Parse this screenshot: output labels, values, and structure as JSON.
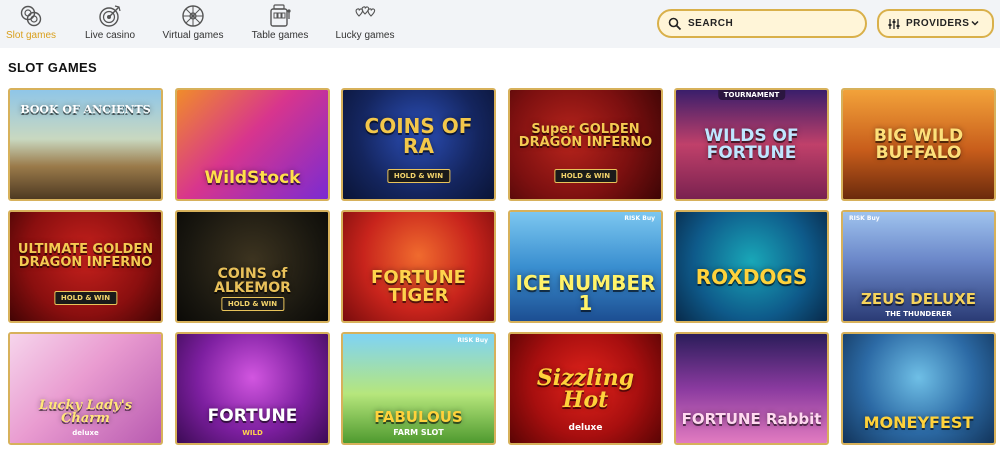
{
  "nav": {
    "items": [
      {
        "label": "Slot games",
        "icon": "slot-chips-icon"
      },
      {
        "label": "Live casino",
        "icon": "target-icon"
      },
      {
        "label": "Virtual games",
        "icon": "wheel-icon"
      },
      {
        "label": "Table games",
        "icon": "slot-machine-icon"
      },
      {
        "label": "Lucky games",
        "icon": "hearts-icon"
      }
    ],
    "active_color": "#d9a01e"
  },
  "search": {
    "placeholder": "SEARCH"
  },
  "providers": {
    "label": "PROVIDERS"
  },
  "section": {
    "title": "SLOT GAMES"
  },
  "games": [
    {
      "title": "BOOK OF ANCIENTS",
      "badge": "",
      "tag": "",
      "risk": "",
      "sub": ""
    },
    {
      "title": "WildStock",
      "badge": "",
      "tag": "",
      "risk": "",
      "sub": ""
    },
    {
      "title": "COINS OF RA",
      "badge": "HOLD & WIN",
      "tag": "",
      "risk": "",
      "sub": ""
    },
    {
      "title": "Super GOLDEN DRAGON INFERNO",
      "badge": "HOLD & WIN",
      "tag": "",
      "risk": "",
      "sub": ""
    },
    {
      "title": "WILDS OF FORTUNE",
      "badge": "",
      "tag": "TOURNAMENT",
      "risk": "",
      "sub": ""
    },
    {
      "title": "BIG WILD BUFFALO",
      "badge": "",
      "tag": "",
      "risk": "",
      "sub": ""
    },
    {
      "title": "ULTIMATE GOLDEN DRAGON INFERNO",
      "badge": "HOLD & WIN",
      "tag": "",
      "risk": "",
      "sub": ""
    },
    {
      "title": "COINS of ALKEMOR",
      "badge": "HOLD & WIN",
      "tag": "",
      "risk": "",
      "sub": ""
    },
    {
      "title": "FORTUNE TIGER",
      "badge": "",
      "tag": "",
      "risk": "",
      "sub": ""
    },
    {
      "title": "ICE NUMBER 1",
      "badge": "",
      "tag": "",
      "risk": "RISK Buy",
      "sub": ""
    },
    {
      "title": "ROXDOGS",
      "badge": "",
      "tag": "",
      "risk": "",
      "sub": ""
    },
    {
      "title": "ZEUS DELUXE",
      "badge": "",
      "tag": "",
      "risk": "RISK Buy",
      "sub": "THE THUNDERER"
    },
    {
      "title": "Lucky Lady's Charm",
      "badge": "",
      "tag": "",
      "risk": "",
      "sub": "deluxe"
    },
    {
      "title": "FORTUNE",
      "badge": "",
      "tag": "",
      "risk": "",
      "sub": "WILD"
    },
    {
      "title": "FABULOUS",
      "badge": "",
      "tag": "",
      "risk": "RISK Buy",
      "sub": "FARM SLOT"
    },
    {
      "title": "Sizzling Hot",
      "badge": "",
      "tag": "",
      "risk": "",
      "sub": "deluxe"
    },
    {
      "title": "FORTUNE Rabbit",
      "badge": "",
      "tag": "",
      "risk": "",
      "sub": ""
    },
    {
      "title": "MONEYFEST",
      "badge": "",
      "tag": "",
      "risk": "",
      "sub": ""
    }
  ]
}
